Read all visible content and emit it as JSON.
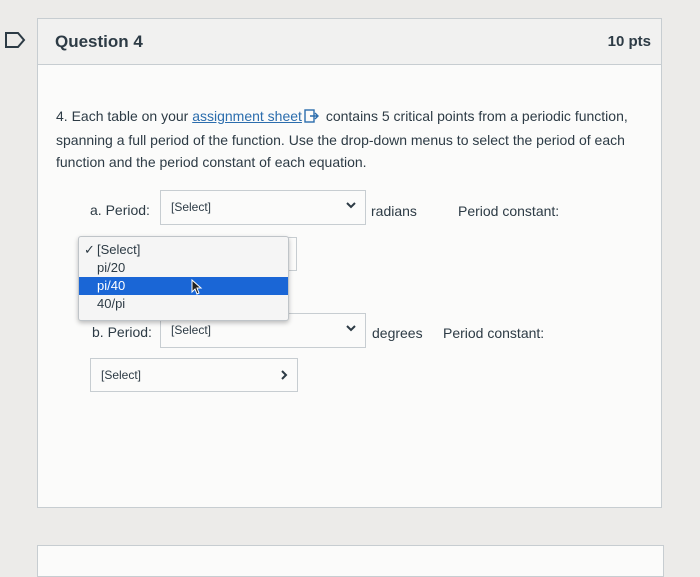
{
  "question": {
    "title": "Question 4",
    "points": "10 pts",
    "text_before_link": "4. Each table on your ",
    "link_text": "assignment sheet",
    "text_after_link": " contains 5 critical points from a periodic function, spanning a full period of the function. Use the drop-down menus to select the period of each function and the period constant of each equation."
  },
  "part_a": {
    "period_label": "a. Period:",
    "period_select": "[Select]",
    "unit": "radians",
    "constant_label": "Period constant:"
  },
  "part_b": {
    "period_label": "b. Period:",
    "period_select": "[Select]",
    "unit": "degrees",
    "constant_label": "Period constant:",
    "constant_select": "[Select]"
  },
  "dropdown": {
    "options": [
      "[Select]",
      "pi/20",
      "pi/40",
      "40/pi"
    ],
    "checked_index": 0,
    "highlighted_index": 2
  },
  "colors": {
    "link": "#2b6dad",
    "highlight": "#1a66d6",
    "text": "#2d3b45"
  }
}
